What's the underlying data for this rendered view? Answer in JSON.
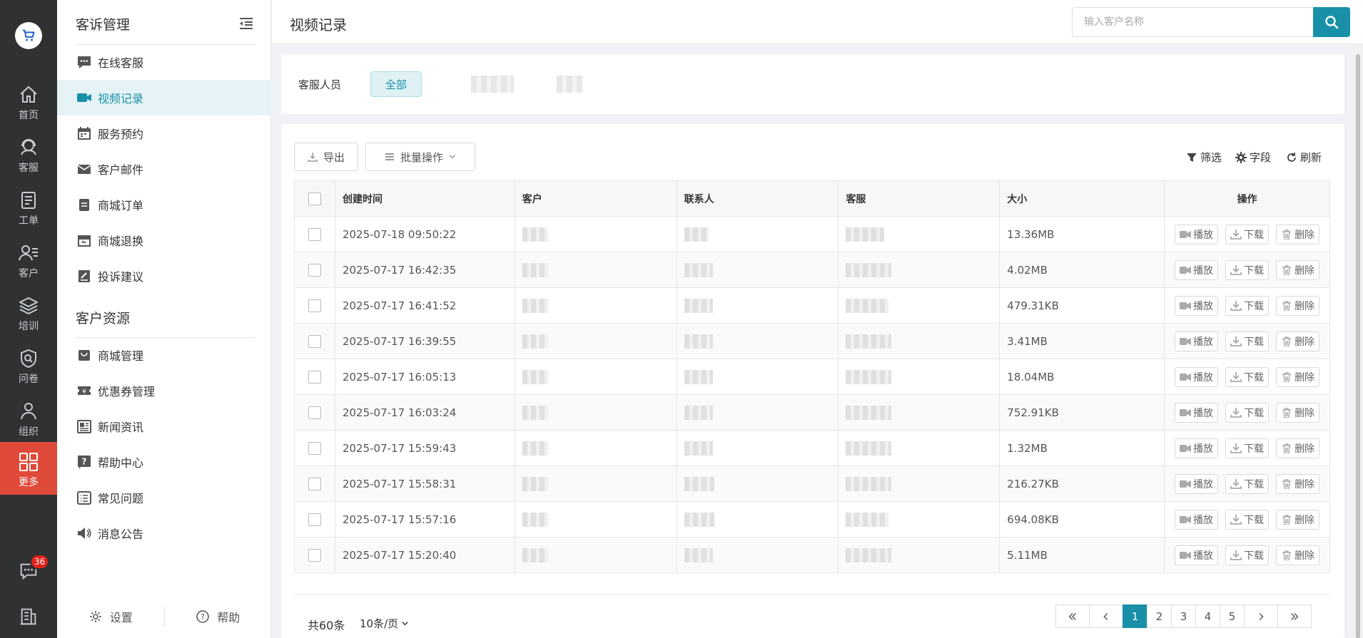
{
  "rail": {
    "items": [
      {
        "label": "首页",
        "icon": "home-icon"
      },
      {
        "label": "客服",
        "icon": "headset-icon"
      },
      {
        "label": "工单",
        "icon": "clipboard-icon"
      },
      {
        "label": "客户",
        "icon": "user-list-icon"
      },
      {
        "label": "培训",
        "icon": "layers-icon"
      },
      {
        "label": "问卷",
        "icon": "shield-search-icon"
      },
      {
        "label": "组织",
        "icon": "group-icon"
      },
      {
        "label": "更多",
        "icon": "grid-icon"
      }
    ],
    "message_badge": "36"
  },
  "menu": {
    "group1": "客诉管理",
    "group1_items": [
      {
        "label": "在线客服",
        "icon": "chat-bubble-icon"
      },
      {
        "label": "视频记录",
        "icon": "video-camera-icon"
      },
      {
        "label": "服务预约",
        "icon": "calendar-icon"
      },
      {
        "label": "客户邮件",
        "icon": "mail-icon"
      },
      {
        "label": "商城订单",
        "icon": "order-clipboard-icon"
      },
      {
        "label": "商城退换",
        "icon": "return-box-icon"
      },
      {
        "label": "投诉建议",
        "icon": "edit-note-icon"
      }
    ],
    "group2": "客户资源",
    "group2_items": [
      {
        "label": "商城管理",
        "icon": "shop-bag-icon"
      },
      {
        "label": "优惠券管理",
        "icon": "coupon-icon"
      },
      {
        "label": "新闻资讯",
        "icon": "newspaper-icon"
      },
      {
        "label": "帮助中心",
        "icon": "help-icon"
      },
      {
        "label": "常见问题",
        "icon": "faq-list-icon"
      },
      {
        "label": "消息公告",
        "icon": "speaker-icon"
      }
    ],
    "footer": {
      "settings": "设置",
      "help": "帮助"
    }
  },
  "header": {
    "title": "视频记录",
    "search_placeholder": "输入客户名称"
  },
  "filter": {
    "label": "客服人员",
    "all": "全部"
  },
  "toolbar": {
    "export": "导出",
    "batch": "批量操作",
    "filter": "筛选",
    "fields": "字段",
    "refresh": "刷新"
  },
  "table": {
    "headers": {
      "time": "创建时间",
      "customer": "客户",
      "contact": "联系人",
      "agent": "客服",
      "size": "大小",
      "ops": "操作"
    },
    "ops": {
      "play": "播放",
      "download": "下载",
      "delete": "删除"
    },
    "rows": [
      {
        "time": "2025-07-18 09:50:22",
        "size": "13.36MB"
      },
      {
        "time": "2025-07-17 16:42:35",
        "size": "4.02MB"
      },
      {
        "time": "2025-07-17 16:41:52",
        "size": "479.31KB"
      },
      {
        "time": "2025-07-17 16:39:55",
        "size": "3.41MB"
      },
      {
        "time": "2025-07-17 16:05:13",
        "size": "18.04MB"
      },
      {
        "time": "2025-07-17 16:03:24",
        "size": "752.91KB"
      },
      {
        "time": "2025-07-17 15:59:43",
        "size": "1.32MB"
      },
      {
        "time": "2025-07-17 15:58:31",
        "size": "216.27KB"
      },
      {
        "time": "2025-07-17 15:57:16",
        "size": "694.08KB"
      },
      {
        "time": "2025-07-17 15:20:40",
        "size": "5.11MB"
      }
    ]
  },
  "pagination": {
    "total": "共60条",
    "page_size": "10条/页",
    "pages": [
      "1",
      "2",
      "3",
      "4",
      "5"
    ],
    "current": "1"
  },
  "colors": {
    "accent": "#1990a8",
    "rail_bg": "#2f3133",
    "rail_active": "#e04a3a"
  }
}
